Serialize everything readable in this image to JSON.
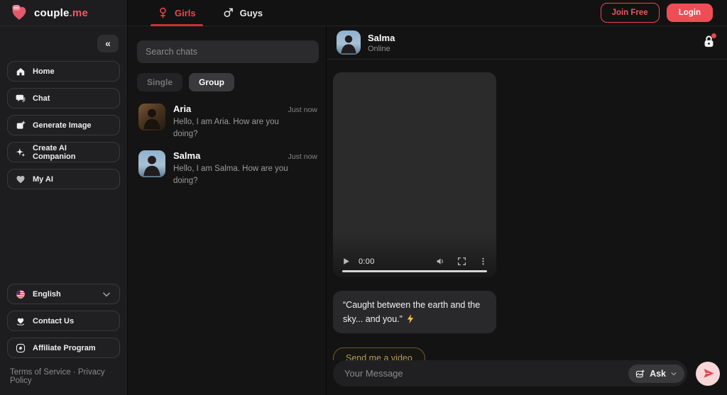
{
  "colors": {
    "accent_red": "#e8474f",
    "login_bg": "#ee4d55",
    "sidebar_bg": "#1d1d1f",
    "panel_bg": "#141414",
    "chip_gold_text": "#b49b5e",
    "chip_gold_border": "#6d5c33",
    "send_button_bg": "#f8d7d8"
  },
  "brand": {
    "name": "couple",
    "tld": ".me",
    "logo_icon": "heart-chat-logo"
  },
  "topnav": {
    "tabs": [
      {
        "label": "Girls",
        "icon": "female-icon",
        "active": true
      },
      {
        "label": "Guys",
        "icon": "male-icon",
        "active": false
      }
    ],
    "join_button": "Join Free",
    "login_button": "Login"
  },
  "sidebar": {
    "collapse_icon_glyph": "«",
    "nav_items": [
      {
        "label": "Home",
        "icon": "home-icon"
      },
      {
        "label": "Chat",
        "icon": "chat-icon"
      },
      {
        "label": "Generate Image",
        "icon": "generate-image-icon"
      },
      {
        "label": "Create AI Companion",
        "icon": "sparkles-icon"
      },
      {
        "label": "My AI",
        "icon": "heart-icon"
      }
    ],
    "language": {
      "label": "English",
      "icon": "us-flag-icon",
      "chevron": "chevron-down-icon"
    },
    "links": [
      {
        "label": "Contact Us",
        "icon": "heart-hands-icon"
      },
      {
        "label": "Affiliate Program",
        "icon": "affiliate-link-icon"
      }
    ],
    "legal": {
      "terms": "Terms of Service",
      "separator": "·",
      "privacy": "Privacy Policy"
    }
  },
  "chat_list": {
    "search_placeholder": "Search chats",
    "filters": [
      {
        "label": "Single",
        "active": false
      },
      {
        "label": "Group",
        "active": true
      }
    ],
    "chats": [
      {
        "name": "Aria",
        "preview": "Hello, I am Aria. How are you doing?",
        "time": "Just now"
      },
      {
        "name": "Salma",
        "preview": "Hello, I am Salma. How are you doing?",
        "time": "Just now"
      }
    ]
  },
  "conversation": {
    "header": {
      "name": "Salma",
      "status": "Online",
      "action_icon": "lock-icon",
      "has_notification_dot": true
    },
    "video": {
      "current_time": "0:00",
      "controls": [
        "play-icon",
        "volume-icon",
        "fullscreen-icon",
        "more-vertical-icon"
      ]
    },
    "message": {
      "text": "“Caught between the earth and the sky... and you.”",
      "emoji": "lightning-bolt"
    },
    "suggested_reply": "Send me a video",
    "composer": {
      "placeholder": "Your Message",
      "ask_label": "Ask",
      "ask_icon": "image-sparkle-icon",
      "send_icon": "send-icon"
    }
  }
}
